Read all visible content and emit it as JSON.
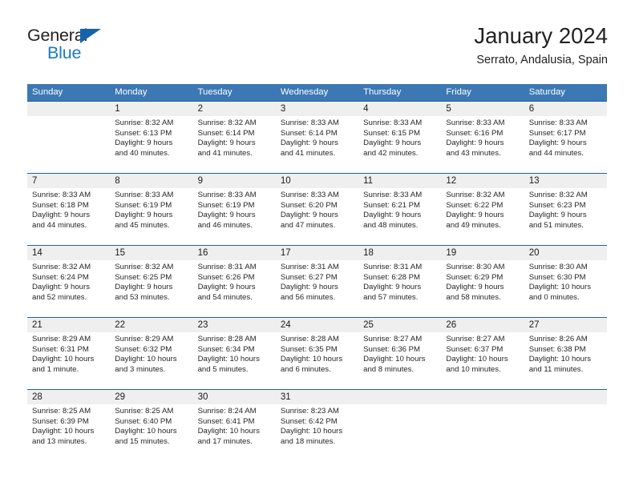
{
  "logo": {
    "text_primary": "General",
    "text_secondary": "Blue",
    "triangle_color": "#1464aa",
    "secondary_color": "#1b79c4"
  },
  "header": {
    "title": "January 2024",
    "subtitle": "Serrato, Andalusia, Spain"
  },
  "theme": {
    "header_band": "#3c78b4",
    "week_divider": "#1f62a8",
    "daynum_band": "#efefef"
  },
  "weekdays": [
    "Sunday",
    "Monday",
    "Tuesday",
    "Wednesday",
    "Thursday",
    "Friday",
    "Saturday"
  ],
  "weeks": [
    {
      "days": [
        {
          "num": "",
          "sunrise": "",
          "sunset": "",
          "daylight1": "",
          "daylight2": ""
        },
        {
          "num": "1",
          "sunrise": "Sunrise: 8:32 AM",
          "sunset": "Sunset: 6:13 PM",
          "daylight1": "Daylight: 9 hours",
          "daylight2": "and 40 minutes."
        },
        {
          "num": "2",
          "sunrise": "Sunrise: 8:32 AM",
          "sunset": "Sunset: 6:14 PM",
          "daylight1": "Daylight: 9 hours",
          "daylight2": "and 41 minutes."
        },
        {
          "num": "3",
          "sunrise": "Sunrise: 8:33 AM",
          "sunset": "Sunset: 6:14 PM",
          "daylight1": "Daylight: 9 hours",
          "daylight2": "and 41 minutes."
        },
        {
          "num": "4",
          "sunrise": "Sunrise: 8:33 AM",
          "sunset": "Sunset: 6:15 PM",
          "daylight1": "Daylight: 9 hours",
          "daylight2": "and 42 minutes."
        },
        {
          "num": "5",
          "sunrise": "Sunrise: 8:33 AM",
          "sunset": "Sunset: 6:16 PM",
          "daylight1": "Daylight: 9 hours",
          "daylight2": "and 43 minutes."
        },
        {
          "num": "6",
          "sunrise": "Sunrise: 8:33 AM",
          "sunset": "Sunset: 6:17 PM",
          "daylight1": "Daylight: 9 hours",
          "daylight2": "and 44 minutes."
        }
      ]
    },
    {
      "days": [
        {
          "num": "7",
          "sunrise": "Sunrise: 8:33 AM",
          "sunset": "Sunset: 6:18 PM",
          "daylight1": "Daylight: 9 hours",
          "daylight2": "and 44 minutes."
        },
        {
          "num": "8",
          "sunrise": "Sunrise: 8:33 AM",
          "sunset": "Sunset: 6:19 PM",
          "daylight1": "Daylight: 9 hours",
          "daylight2": "and 45 minutes."
        },
        {
          "num": "9",
          "sunrise": "Sunrise: 8:33 AM",
          "sunset": "Sunset: 6:19 PM",
          "daylight1": "Daylight: 9 hours",
          "daylight2": "and 46 minutes."
        },
        {
          "num": "10",
          "sunrise": "Sunrise: 8:33 AM",
          "sunset": "Sunset: 6:20 PM",
          "daylight1": "Daylight: 9 hours",
          "daylight2": "and 47 minutes."
        },
        {
          "num": "11",
          "sunrise": "Sunrise: 8:33 AM",
          "sunset": "Sunset: 6:21 PM",
          "daylight1": "Daylight: 9 hours",
          "daylight2": "and 48 minutes."
        },
        {
          "num": "12",
          "sunrise": "Sunrise: 8:32 AM",
          "sunset": "Sunset: 6:22 PM",
          "daylight1": "Daylight: 9 hours",
          "daylight2": "and 49 minutes."
        },
        {
          "num": "13",
          "sunrise": "Sunrise: 8:32 AM",
          "sunset": "Sunset: 6:23 PM",
          "daylight1": "Daylight: 9 hours",
          "daylight2": "and 51 minutes."
        }
      ]
    },
    {
      "days": [
        {
          "num": "14",
          "sunrise": "Sunrise: 8:32 AM",
          "sunset": "Sunset: 6:24 PM",
          "daylight1": "Daylight: 9 hours",
          "daylight2": "and 52 minutes."
        },
        {
          "num": "15",
          "sunrise": "Sunrise: 8:32 AM",
          "sunset": "Sunset: 6:25 PM",
          "daylight1": "Daylight: 9 hours",
          "daylight2": "and 53 minutes."
        },
        {
          "num": "16",
          "sunrise": "Sunrise: 8:31 AM",
          "sunset": "Sunset: 6:26 PM",
          "daylight1": "Daylight: 9 hours",
          "daylight2": "and 54 minutes."
        },
        {
          "num": "17",
          "sunrise": "Sunrise: 8:31 AM",
          "sunset": "Sunset: 6:27 PM",
          "daylight1": "Daylight: 9 hours",
          "daylight2": "and 56 minutes."
        },
        {
          "num": "18",
          "sunrise": "Sunrise: 8:31 AM",
          "sunset": "Sunset: 6:28 PM",
          "daylight1": "Daylight: 9 hours",
          "daylight2": "and 57 minutes."
        },
        {
          "num": "19",
          "sunrise": "Sunrise: 8:30 AM",
          "sunset": "Sunset: 6:29 PM",
          "daylight1": "Daylight: 9 hours",
          "daylight2": "and 58 minutes."
        },
        {
          "num": "20",
          "sunrise": "Sunrise: 8:30 AM",
          "sunset": "Sunset: 6:30 PM",
          "daylight1": "Daylight: 10 hours",
          "daylight2": "and 0 minutes."
        }
      ]
    },
    {
      "days": [
        {
          "num": "21",
          "sunrise": "Sunrise: 8:29 AM",
          "sunset": "Sunset: 6:31 PM",
          "daylight1": "Daylight: 10 hours",
          "daylight2": "and 1 minute."
        },
        {
          "num": "22",
          "sunrise": "Sunrise: 8:29 AM",
          "sunset": "Sunset: 6:32 PM",
          "daylight1": "Daylight: 10 hours",
          "daylight2": "and 3 minutes."
        },
        {
          "num": "23",
          "sunrise": "Sunrise: 8:28 AM",
          "sunset": "Sunset: 6:34 PM",
          "daylight1": "Daylight: 10 hours",
          "daylight2": "and 5 minutes."
        },
        {
          "num": "24",
          "sunrise": "Sunrise: 8:28 AM",
          "sunset": "Sunset: 6:35 PM",
          "daylight1": "Daylight: 10 hours",
          "daylight2": "and 6 minutes."
        },
        {
          "num": "25",
          "sunrise": "Sunrise: 8:27 AM",
          "sunset": "Sunset: 6:36 PM",
          "daylight1": "Daylight: 10 hours",
          "daylight2": "and 8 minutes."
        },
        {
          "num": "26",
          "sunrise": "Sunrise: 8:27 AM",
          "sunset": "Sunset: 6:37 PM",
          "daylight1": "Daylight: 10 hours",
          "daylight2": "and 10 minutes."
        },
        {
          "num": "27",
          "sunrise": "Sunrise: 8:26 AM",
          "sunset": "Sunset: 6:38 PM",
          "daylight1": "Daylight: 10 hours",
          "daylight2": "and 11 minutes."
        }
      ]
    },
    {
      "days": [
        {
          "num": "28",
          "sunrise": "Sunrise: 8:25 AM",
          "sunset": "Sunset: 6:39 PM",
          "daylight1": "Daylight: 10 hours",
          "daylight2": "and 13 minutes."
        },
        {
          "num": "29",
          "sunrise": "Sunrise: 8:25 AM",
          "sunset": "Sunset: 6:40 PM",
          "daylight1": "Daylight: 10 hours",
          "daylight2": "and 15 minutes."
        },
        {
          "num": "30",
          "sunrise": "Sunrise: 8:24 AM",
          "sunset": "Sunset: 6:41 PM",
          "daylight1": "Daylight: 10 hours",
          "daylight2": "and 17 minutes."
        },
        {
          "num": "31",
          "sunrise": "Sunrise: 8:23 AM",
          "sunset": "Sunset: 6:42 PM",
          "daylight1": "Daylight: 10 hours",
          "daylight2": "and 18 minutes."
        },
        {
          "num": "",
          "sunrise": "",
          "sunset": "",
          "daylight1": "",
          "daylight2": ""
        },
        {
          "num": "",
          "sunrise": "",
          "sunset": "",
          "daylight1": "",
          "daylight2": ""
        },
        {
          "num": "",
          "sunrise": "",
          "sunset": "",
          "daylight1": "",
          "daylight2": ""
        }
      ]
    }
  ]
}
